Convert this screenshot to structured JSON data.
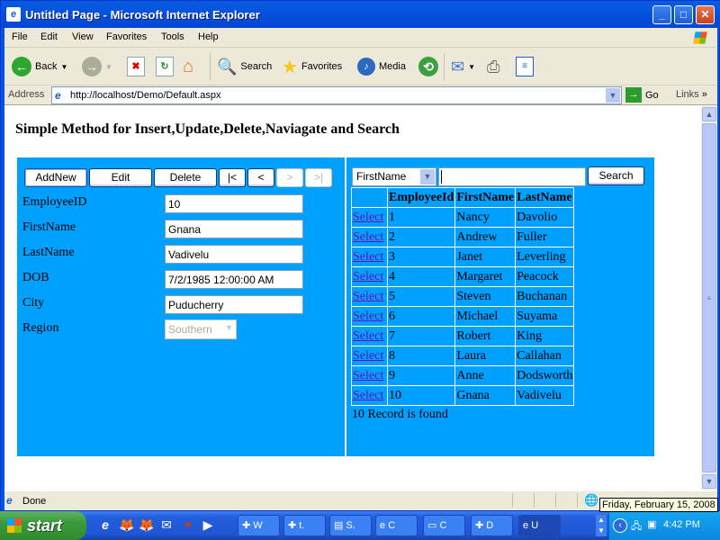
{
  "window": {
    "title": "Untitled Page - Microsoft Internet Explorer",
    "controls": [
      "minimize",
      "maximize",
      "close"
    ]
  },
  "menubar": [
    "File",
    "Edit",
    "View",
    "Favorites",
    "Tools",
    "Help"
  ],
  "toolbar": {
    "back": "Back",
    "search": "Search",
    "favorites": "Favorites",
    "media": "Media"
  },
  "address": {
    "label": "Address",
    "url": "http://localhost/Demo/Default.aspx",
    "go": "Go",
    "links": "Links"
  },
  "page": {
    "title": "Simple Method for Insert,Update,Delete,Naviagate and Search",
    "panel_color": "#00a0ff",
    "buttons": {
      "addnew": "AddNew",
      "edit": "Edit",
      "delete": "Delete",
      "first": "|<",
      "prev": "<",
      "next": ">",
      "last": ">|"
    },
    "form": {
      "employee_id": {
        "label": "EmployeeID",
        "value": "10"
      },
      "first_name": {
        "label": "FirstName",
        "value": "Gnana"
      },
      "last_name": {
        "label": "LastName",
        "value": "Vadivelu"
      },
      "dob": {
        "label": "DOB",
        "value": "7/2/1985 12:00:00 AM"
      },
      "city": {
        "label": "City",
        "value": "Puducherry"
      },
      "region": {
        "label": "Region",
        "value": "Southern"
      }
    },
    "search": {
      "field_selected": "FirstName",
      "query": "",
      "button": "Search"
    },
    "grid": {
      "headers": [
        "",
        "EmployeeId",
        "FirstName",
        "LastName"
      ],
      "select_label": "Select",
      "rows": [
        {
          "id": "1",
          "first": "Nancy",
          "last": "Davolio"
        },
        {
          "id": "2",
          "first": "Andrew",
          "last": "Fuller"
        },
        {
          "id": "3",
          "first": "Janet",
          "last": "Leverling"
        },
        {
          "id": "4",
          "first": "Margaret",
          "last": "Peacock"
        },
        {
          "id": "5",
          "first": "Steven",
          "last": "Buchanan"
        },
        {
          "id": "6",
          "first": "Michael",
          "last": "Suyama"
        },
        {
          "id": "7",
          "first": "Robert",
          "last": "King"
        },
        {
          "id": "8",
          "first": "Laura",
          "last": "Callahan"
        },
        {
          "id": "9",
          "first": "Anne",
          "last": "Dodsworth"
        },
        {
          "id": "10",
          "first": "Gnana",
          "last": "Vadivelu"
        }
      ],
      "footer": "10 Record is found"
    }
  },
  "status": {
    "text": "Done",
    "tooltip": "Friday, February 15, 2008"
  },
  "taskbar": {
    "start": "start",
    "tasks": [
      "W",
      "t.",
      "S.",
      "C",
      "C",
      "D",
      "U"
    ],
    "clock": "4:42 PM"
  }
}
